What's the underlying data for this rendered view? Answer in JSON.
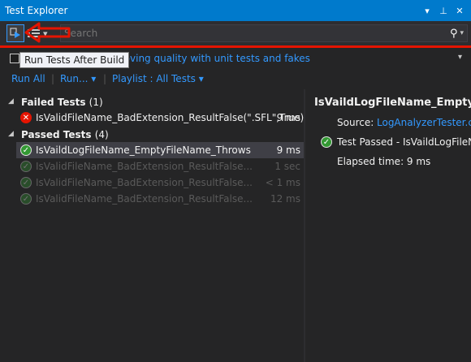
{
  "window": {
    "title": "Test Explorer",
    "controls": [
      "▾",
      "⊥",
      "✕"
    ]
  },
  "toolbar": {
    "run_after_build_tooltip": "Run Tests After Build",
    "search_placeholder": "Search",
    "search_icon": "search-icon"
  },
  "banner": {
    "link_text": "roving quality with unit tests and fakes"
  },
  "commands": {
    "run_all": "Run All",
    "run": "Run...",
    "playlist": "Playlist : All Tests",
    "separator": "|"
  },
  "groups": {
    "failed": {
      "label": "Failed Tests",
      "count": "(1)"
    },
    "passed": {
      "label": "Passed Tests",
      "count": "(4)"
    }
  },
  "failed_tests": [
    {
      "name": "IsValidFileName_BadExtension_ResultFalse(\".SFL\",True)",
      "time": "9 ms",
      "status": "failed"
    }
  ],
  "passed_tests": [
    {
      "name": "IsVaildLogFileName_EmptyFileName_Throws",
      "time": "9 ms",
      "status": "passed",
      "selected": true
    },
    {
      "name": "IsValidFileName_BadExtension_ResultFalse...",
      "time": "1 sec",
      "status": "passed",
      "dim": true
    },
    {
      "name": "IsValidFileName_BadExtension_ResultFalse...",
      "time": "< 1 ms",
      "status": "passed",
      "dim": true
    },
    {
      "name": "IsValidFileName_BadExtension_ResultFalse...",
      "time": "12 ms",
      "status": "passed",
      "dim": true
    }
  ],
  "detail": {
    "title": "IsVaildLogFileName_EmptyFi",
    "source_label": "Source:",
    "source_link": "LogAnalyzerTester.cs",
    "status_text": "Test Passed - IsVaildLogFileN",
    "elapsed": "Elapsed time: 9 ms"
  },
  "colors": {
    "accent": "#007acc",
    "link": "#3399ff",
    "fail": "#e51400",
    "pass": "#339933",
    "highlight_annotation": "#e51400"
  }
}
